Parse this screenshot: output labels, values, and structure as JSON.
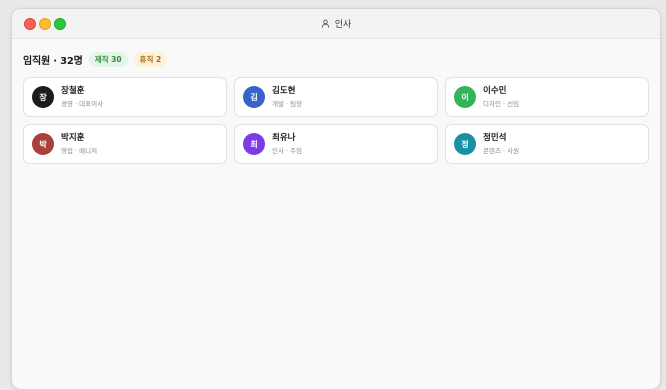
{
  "window": {
    "title": "인사",
    "title_icon": "person-icon"
  },
  "header": {
    "title": "임직원 · 32명",
    "badges": [
      {
        "label": "재직 30",
        "color": "#2f8c44"
      },
      {
        "label": "휴직 2",
        "color": "#a86b12"
      }
    ]
  },
  "employees": [
    {
      "initial": "장",
      "name": "장철훈",
      "role": "경영 · 대표이사",
      "color": "#1c1c1e"
    },
    {
      "initial": "김",
      "name": "김도현",
      "role": "개발 · 팀장",
      "color": "#3a63c9"
    },
    {
      "initial": "이",
      "name": "이수민",
      "role": "디자인 · 선임",
      "color": "#34b35a"
    },
    {
      "initial": "박",
      "name": "박지훈",
      "role": "영업 · 매니저",
      "color": "#a8403c"
    },
    {
      "initial": "최",
      "name": "최유나",
      "role": "인사 · 주임",
      "color": "#7b3ce6"
    },
    {
      "initial": "정",
      "name": "정민석",
      "role": "콘텐츠 · 사원",
      "color": "#1b8fa3"
    }
  ]
}
